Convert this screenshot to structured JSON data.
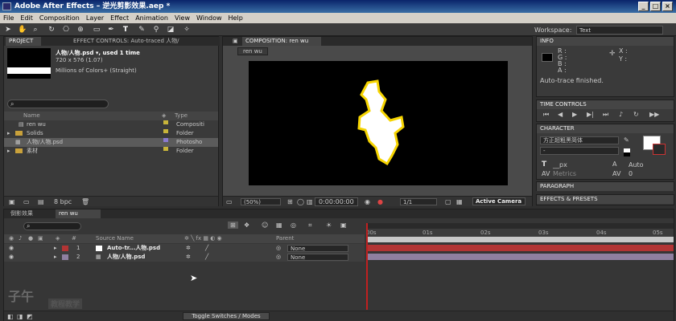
{
  "title": "Adobe After Effects – 逆光剪影效果.aep *",
  "window_buttons": [
    "_",
    "□",
    "×"
  ],
  "menu": [
    "File",
    "Edit",
    "Composition",
    "Layer",
    "Effect",
    "Animation",
    "View",
    "Window",
    "Help"
  ],
  "workspace": {
    "label": "Workspace:",
    "value": "Text"
  },
  "project": {
    "tab_project": "PROJECT",
    "tab_effect": "EFFECT CONTROLS: Auto-traced 人物/",
    "item_name": "人物/人物.psd ▾, used 1 time",
    "item_dims": "720 x 576 (1.07)",
    "item_color": "Millions of Colors+ (Straight)",
    "search_placeholder": "",
    "col_name": "Name",
    "col_type": "Type",
    "rows": [
      {
        "name": "ren wu",
        "type": "Compositi"
      },
      {
        "name": "Solids",
        "type": "Folder"
      },
      {
        "name": "人物/人物.psd",
        "type": "Photosho"
      },
      {
        "name": "素材",
        "type": "Folder"
      }
    ],
    "bpc": "8 bpc"
  },
  "composition": {
    "tab": "COMPOSITION: ren wu",
    "subtab": "ren wu",
    "zoom": "(50%)",
    "timecode": "0:00:00:00",
    "resolution": "1/1",
    "camera": "Active Camera"
  },
  "info": {
    "tab": "INFO",
    "r": "R :",
    "g": "G :",
    "b": "B :",
    "a": "A :",
    "x": "X :",
    "y": "Y :",
    "message": "Auto-trace finished."
  },
  "time_controls": {
    "tab": "TIME CONTROLS"
  },
  "character": {
    "tab": "CHARACTER",
    "font": "方正超粗黑简体",
    "style": "-",
    "size_unit": "__px",
    "leading": "Auto",
    "metrics": "Metrics",
    "tracking": "0"
  },
  "paragraph": {
    "tab": "PARAGRAPH"
  },
  "effects": {
    "tab": "EFFECTS & PRESETS"
  },
  "timeline": {
    "tab1": "倒影效果",
    "tab2": "ren wu",
    "col_source": "Source Name",
    "col_parent": "Parent",
    "layers": [
      {
        "num": "1",
        "name": "Auto-tr...人物.psd",
        "parent": "None",
        "color": "#b03030"
      },
      {
        "num": "2",
        "name": "人物/人物.psd",
        "parent": "None",
        "color": "#9a80a0"
      }
    ],
    "ruler": [
      "00s",
      "01s",
      "02s",
      "03s",
      "04s",
      "05s"
    ],
    "toggle": "Toggle Switches / Modes"
  },
  "watermark": {
    "logo": "子午",
    "text": "教程教学"
  },
  "colors": {
    "accent": "#f6d400",
    "layer1": "#b23434",
    "layer2": "#8f80a0",
    "playhead": "#c02020"
  }
}
